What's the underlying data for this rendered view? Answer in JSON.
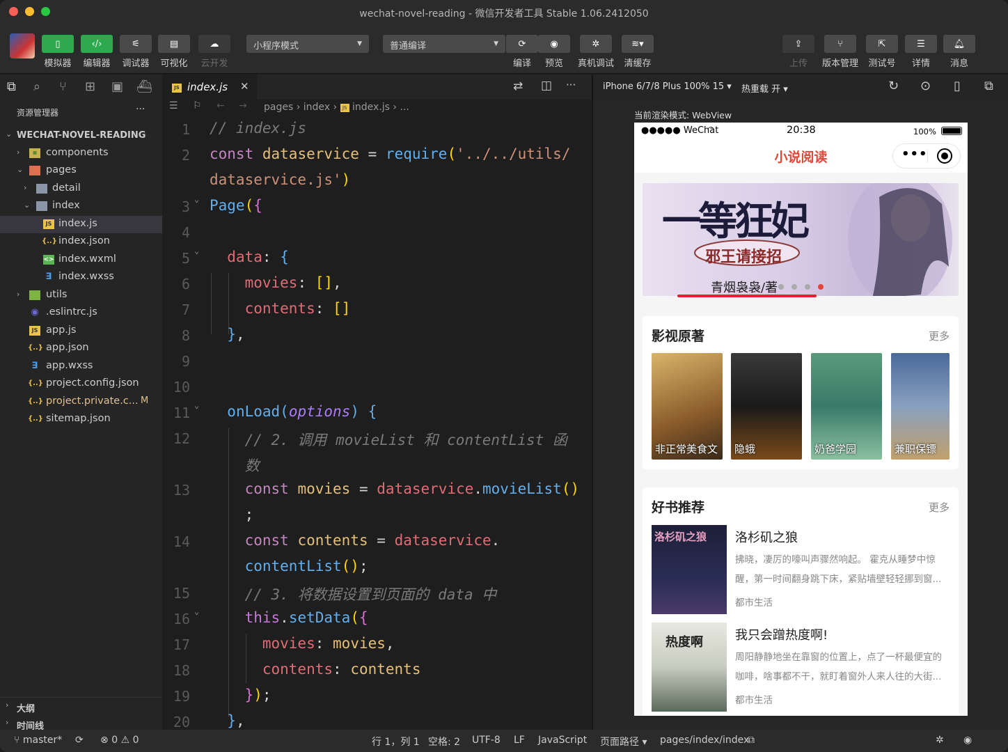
{
  "window": {
    "title": "wechat-novel-reading - 微信开发者工具 Stable 1.06.2412050"
  },
  "toolbar": {
    "simulator": "模拟器",
    "editor": "编辑器",
    "debugger": "调试器",
    "visual": "可视化",
    "cloud": "云开发",
    "mode_select": "小程序模式",
    "compile_select": "普通编译",
    "compile": "编译",
    "preview": "预览",
    "remote_debug": "真机调试",
    "clear_cache": "清缓存",
    "upload": "上传",
    "version": "版本管理",
    "test_account": "测试号",
    "details": "详情",
    "messages": "消息"
  },
  "explorer": {
    "header": "资源管理器",
    "root": "WECHAT-NOVEL-READING",
    "items": [
      {
        "name": "components",
        "icon": "folder-icon"
      },
      {
        "name": "pages",
        "icon": "folder-open-icon"
      },
      {
        "name": "detail",
        "icon": "folder-icon"
      },
      {
        "name": "index",
        "icon": "folder-open-icon"
      },
      {
        "name": "index.js",
        "icon": "js-file-icon"
      },
      {
        "name": "index.json",
        "icon": "json-file-icon"
      },
      {
        "name": "index.wxml",
        "icon": "wxml-file-icon"
      },
      {
        "name": "index.wxss",
        "icon": "wxss-file-icon"
      },
      {
        "name": "utils",
        "icon": "folder-icon"
      },
      {
        "name": ".eslintrc.js",
        "icon": "eslint-icon"
      },
      {
        "name": "app.js",
        "icon": "js-file-icon"
      },
      {
        "name": "app.json",
        "icon": "json-file-icon"
      },
      {
        "name": "app.wxss",
        "icon": "wxss-file-icon"
      },
      {
        "name": "project.config.json",
        "icon": "json-file-icon"
      },
      {
        "name": "project.private.c...",
        "icon": "json-file-icon",
        "badge": "M"
      },
      {
        "name": "sitemap.json",
        "icon": "json-file-icon"
      }
    ],
    "outline": "大纲",
    "timeline": "时间线"
  },
  "editor": {
    "tab": "index.js",
    "breadcrumb": [
      "pages",
      "index",
      "index.js",
      "..."
    ],
    "line_numbers": [
      "1",
      "2",
      "",
      "3",
      "4",
      "5",
      "6",
      "7",
      "8",
      "9",
      "10",
      "11",
      "12",
      "",
      "13",
      "",
      "14",
      "",
      "15",
      "16",
      "17",
      "18",
      "19",
      "20"
    ]
  },
  "simulator": {
    "device": "iPhone 6/7/8 Plus 100% 15 ▾",
    "hot_reload": "热重载 开 ▾",
    "render_mode": "当前渲染模式: WebView",
    "status": {
      "carrier": "●●●●● WeChat",
      "time": "20:38",
      "battery": "100%"
    },
    "nav_title": "小说阅读",
    "banner": {
      "title": "一等狂妃",
      "subtitle": "邪王请接招",
      "author": "青烟袅袅/著"
    },
    "section1": {
      "title": "影视原著",
      "more": "更多",
      "books": [
        "非正常美食文",
        "隐蛾",
        "奶爸学园",
        "兼职保镖"
      ]
    },
    "section2": {
      "title": "好书推荐",
      "more": "更多",
      "books": [
        {
          "title": "洛杉矶之狼",
          "desc": "拂晓，凄厉的嚎叫声骤然响起。 霍克从睡梦中惊醒，第一时间翻身跳下床，紧贴墙壁轻轻挪到窗...",
          "tag": "都市生活",
          "cover_text": "洛杉矶之狼"
        },
        {
          "title": "我只会蹭热度啊!",
          "desc": "周阳静静地坐在靠窗的位置上，点了一杯最便宜的咖啡，啥事都不干，就盯着窗外人来人往的大街...",
          "tag": "都市生活",
          "cover_text": "热度啊"
        }
      ]
    }
  },
  "statusbar": {
    "branch": "master*",
    "errors": "0",
    "warnings": "0",
    "position": "行 1，列 1",
    "spaces": "空格: 2",
    "encoding": "UTF-8",
    "eol": "LF",
    "language": "JavaScript",
    "page_path_label": "页面路径 ▾",
    "page_path": "pages/index/index"
  }
}
